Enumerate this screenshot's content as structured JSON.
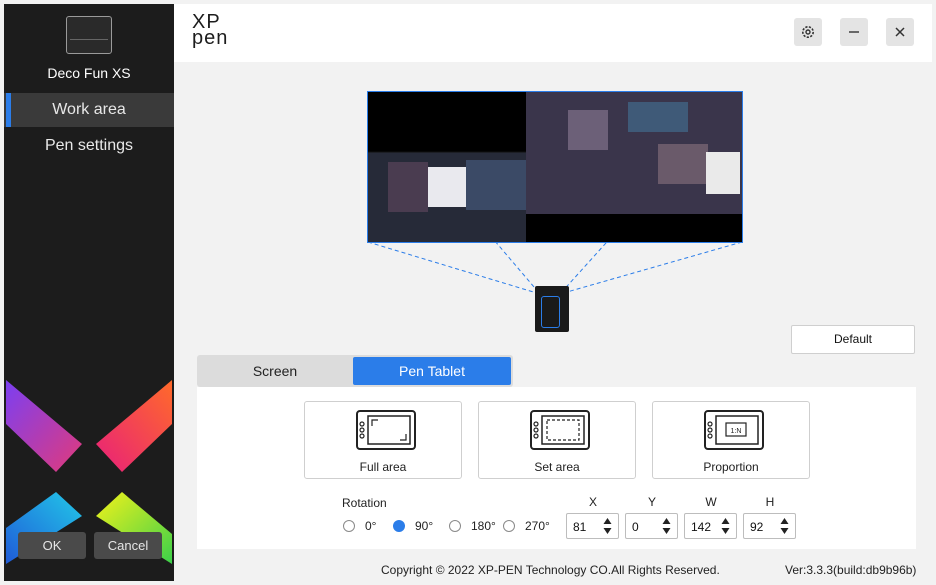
{
  "colors": {
    "accent": "#2b7de9",
    "sidebar_bg": "#1c1c1c",
    "sidebar_active": "#3a3a3a"
  },
  "sidebar": {
    "device_name": "Deco Fun XS",
    "items": [
      {
        "label": "Work area",
        "active": true
      },
      {
        "label": "Pen settings",
        "active": false
      }
    ],
    "ok_label": "OK",
    "cancel_label": "Cancel"
  },
  "header": {
    "logo_top": "XP",
    "logo_bottom": "pen",
    "icons": [
      "gear-icon",
      "minimize-icon",
      "close-icon"
    ]
  },
  "default_label": "Default",
  "tabs": [
    {
      "label": "Screen",
      "active": false
    },
    {
      "label": "Pen Tablet",
      "active": true
    }
  ],
  "area_options": [
    {
      "label": "Full area",
      "icon": "full-area-icon"
    },
    {
      "label": "Set area",
      "icon": "set-area-icon"
    },
    {
      "label": "Proportion",
      "icon": "proportion-icon",
      "badge": "1:N"
    }
  ],
  "rotation": {
    "label": "Rotation",
    "options": [
      "0°",
      "90°",
      "180°",
      "270°"
    ],
    "selected": "90°"
  },
  "coords": {
    "headers": [
      "X",
      "Y",
      "W",
      "H"
    ],
    "values": [
      "81",
      "0",
      "142",
      "92"
    ]
  },
  "footer": {
    "copyright": "Copyright © 2022  XP-PEN Technology CO.All Rights Reserved.",
    "version": "Ver:3.3.3(build:db9b96b)"
  }
}
